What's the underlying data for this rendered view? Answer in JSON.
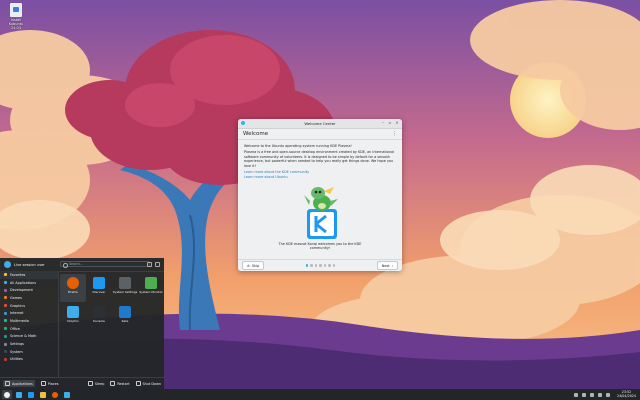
{
  "desktop": {
    "icon_label_line1": "Install Kubuntu",
    "icon_label_line2": "24.04"
  },
  "welcome_window": {
    "title": "Welcome Center",
    "heading": "Welcome",
    "intro": "Welcome to the Ubuntu operating system running KDE Plasma!",
    "body": "Plasma is a free and open-source desktop environment created by KDE, an international software community of volunteers. It is designed to be simple by default for a smooth experience, but powerful when needed to help you really get things done. We hope you love it!",
    "link_1": "Learn more about the KDE community",
    "link_2": "Learn more about Ubuntu",
    "caption_line1": "The KDE mascot Konqi welcomes you to the KDE",
    "caption_line2": "community!",
    "skip_label": "Skip",
    "next_label": "Next",
    "page_count": 7,
    "current_page": 1,
    "colors": {
      "accent": "#3daee9",
      "link": "#2980b9"
    }
  },
  "launcher": {
    "user_name": "Live session user",
    "search_placeholder": "Search…",
    "categories": [
      {
        "label": "Favorites",
        "icon": "star-icon",
        "color": "#f3c623"
      },
      {
        "label": "All Applications",
        "icon": "grid-icon",
        "color": "#3daee9"
      },
      {
        "label": "Development",
        "icon": "code-icon",
        "color": "#9b59b6"
      },
      {
        "label": "Games",
        "icon": "gamepad-icon",
        "color": "#e67e22"
      },
      {
        "label": "Graphics",
        "icon": "palette-icon",
        "color": "#e74c3c"
      },
      {
        "label": "Internet",
        "icon": "globe-icon",
        "color": "#3498db"
      },
      {
        "label": "Multimedia",
        "icon": "film-icon",
        "color": "#1abc9c"
      },
      {
        "label": "Office",
        "icon": "document-icon",
        "color": "#27ae60"
      },
      {
        "label": "Science & Math",
        "icon": "flask-icon",
        "color": "#16a085"
      },
      {
        "label": "Settings",
        "icon": "gear-icon",
        "color": "#7f8c8d"
      },
      {
        "label": "System",
        "icon": "computer-icon",
        "color": "#34495e"
      },
      {
        "label": "Utilities",
        "icon": "tools-icon",
        "color": "#c0392b"
      }
    ],
    "apps": [
      {
        "label": "Firefox",
        "icon": "firefox-icon",
        "color": "#e66000"
      },
      {
        "label": "Discover",
        "icon": "discover-icon",
        "color": "#1d99f3"
      },
      {
        "label": "System Settings",
        "icon": "settings-icon",
        "color": "#5a6268"
      },
      {
        "label": "System Monitor",
        "icon": "monitor-icon",
        "color": "#4caf50"
      },
      {
        "label": "Dolphin",
        "icon": "folder-icon",
        "color": "#3daee9"
      },
      {
        "label": "Konsole",
        "icon": "terminal-icon",
        "color": "#2c3034"
      },
      {
        "label": "Kate",
        "icon": "editor-icon",
        "color": "#1f7ac9"
      }
    ],
    "footer": {
      "applications": "Applications",
      "places": "Places",
      "sleep": "Sleep",
      "restart": "Restart",
      "shutdown": "Shut Down"
    }
  },
  "taskbar": {
    "items": [
      {
        "icon": "kde-launcher-icon",
        "color": "#eff0f1"
      },
      {
        "icon": "desktop-icon",
        "color": "#3daee9"
      },
      {
        "icon": "mail-icon",
        "color": "#1d99f3"
      },
      {
        "icon": "dolphin-icon",
        "color": "#f0c040"
      },
      {
        "icon": "firefox-icon",
        "color": "#e66000"
      },
      {
        "icon": "welcome-icon",
        "color": "#3daee9"
      }
    ],
    "clock_time": "23:52",
    "clock_date": "24/04/2024"
  }
}
